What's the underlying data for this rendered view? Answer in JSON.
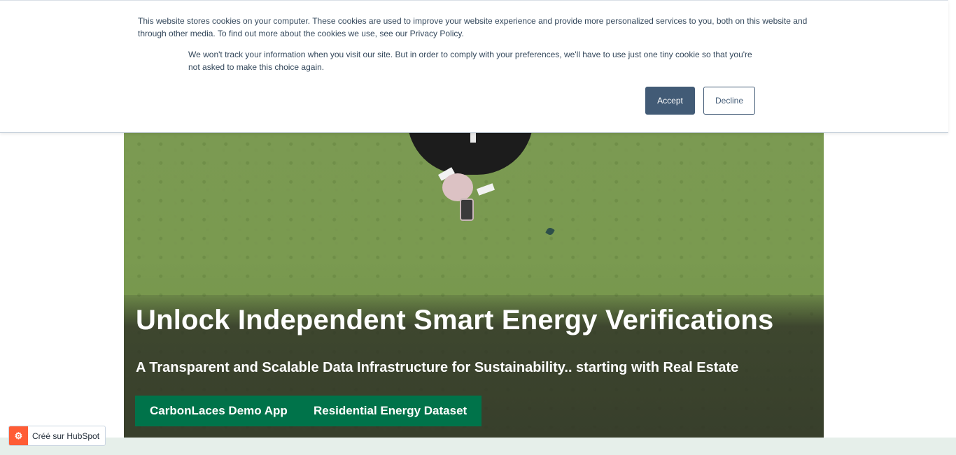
{
  "cookie_banner": {
    "text_primary": "This website stores cookies on your computer. These cookies are used to improve your website experience and provide more personalized services to you, both on this website and through other media. To find out more about the cookies we use, see our Privacy Policy.",
    "text_secondary": "We won't track your information when you visit our site. But in order to comply with your preferences, we'll have to use just one tiny cookie so that you're not asked to make this choice again.",
    "accept_label": "Accept",
    "decline_label": "Decline",
    "accept_color": "#425b76"
  },
  "hero": {
    "title": "Unlock Independent Smart Energy Verifications",
    "subtitle": "A Transparent and Scalable Data Infrastructure for Sustainability.. starting with Real Estate",
    "buttons": [
      {
        "label": "CarbonLaces Demo App"
      },
      {
        "label": "Residential Energy Dataset"
      }
    ],
    "button_color": "#00734a"
  },
  "hubspot_badge": {
    "label": "Créé sur HubSpot",
    "icon": "hubspot-sprocket-icon",
    "icon_glyph": "⚙",
    "color": "#ff5c35"
  }
}
